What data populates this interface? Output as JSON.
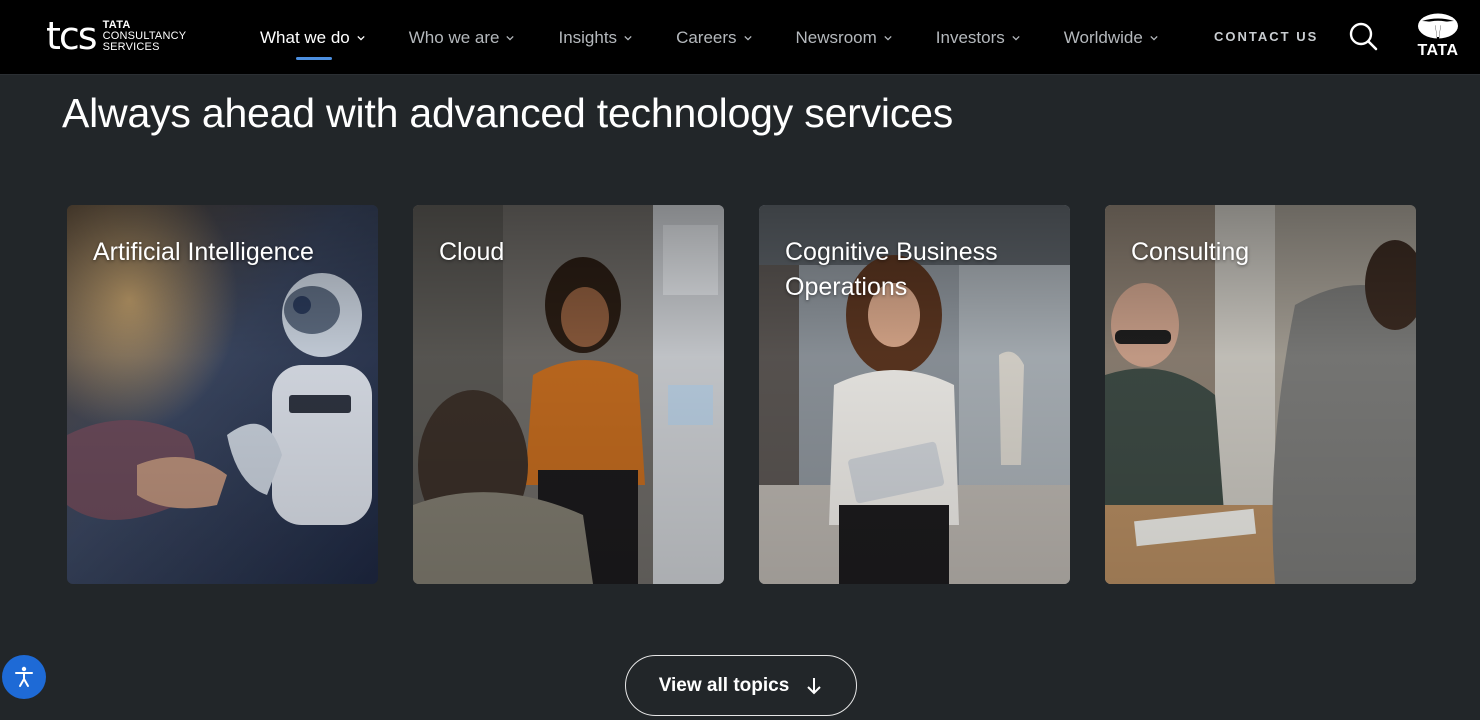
{
  "header": {
    "logo": {
      "mark": "tcs",
      "line1": "TATA",
      "line2": "CONSULTANCY",
      "line3": "SERVICES"
    },
    "nav": [
      {
        "label": "What we do",
        "active": true
      },
      {
        "label": "Who we are"
      },
      {
        "label": "Insights"
      },
      {
        "label": "Careers"
      },
      {
        "label": "Newsroom"
      },
      {
        "label": "Investors"
      },
      {
        "label": "Worldwide"
      }
    ],
    "contact_label": "CONTACT US",
    "brand_word": "TATA"
  },
  "main": {
    "headline": "Always ahead with advanced technology services",
    "cards": [
      {
        "title": "Artificial Intelligence"
      },
      {
        "title": "Cloud"
      },
      {
        "title": "Cognitive Business Operations"
      },
      {
        "title": "Consulting"
      }
    ],
    "view_all_label": "View all topics"
  },
  "colors": {
    "page_background": "#222629",
    "header_background": "#000000",
    "nav_active_underline": "#4c8fe0",
    "accessibility_button": "#1e6ad6"
  },
  "icons": [
    "chevron-down-icon",
    "search-icon",
    "tata-logo-icon",
    "arrow-down-icon",
    "accessibility-icon"
  ]
}
